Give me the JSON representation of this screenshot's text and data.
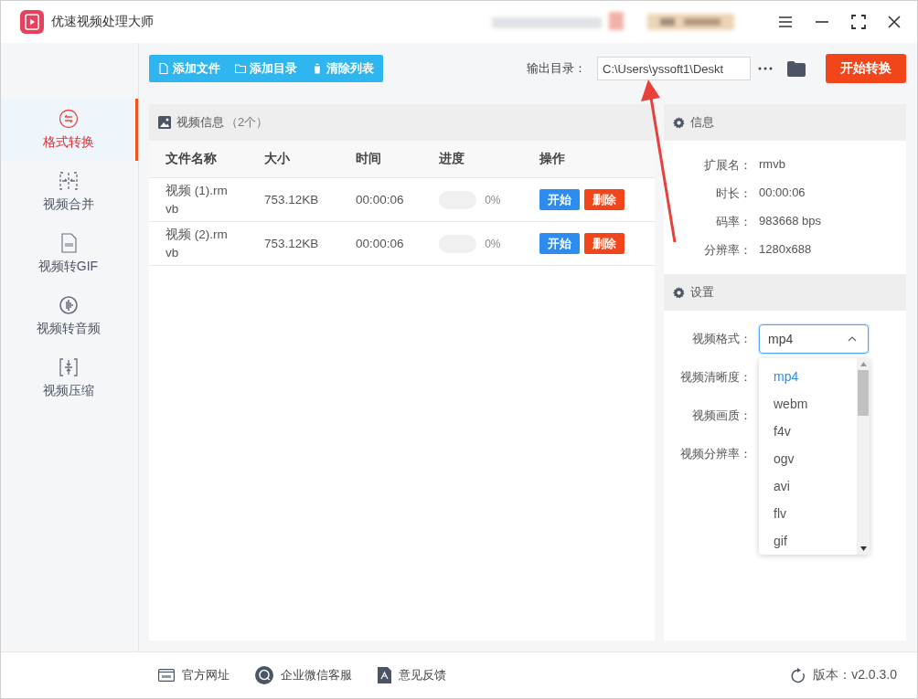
{
  "window": {
    "title": "优速视频处理大师"
  },
  "sidebar": {
    "items": [
      {
        "label": "格式转换",
        "selected": true
      },
      {
        "label": "视频合并",
        "selected": false
      },
      {
        "label": "视频转GIF",
        "selected": false
      },
      {
        "label": "视频转音频",
        "selected": false
      },
      {
        "label": "视频压缩",
        "selected": false
      }
    ]
  },
  "toolbar": {
    "buttons": [
      {
        "label": "添加文件"
      },
      {
        "label": "添加目录"
      },
      {
        "label": "清除列表"
      }
    ],
    "output_label": "输出目录：",
    "output_path": "C:\\Users\\yssoft1\\Deskt",
    "start_button": "开始转换"
  },
  "file_panel": {
    "title": "视频信息",
    "count": "（2个）",
    "columns": [
      "文件名称",
      "大小",
      "时间",
      "进度",
      "操作"
    ],
    "rows": [
      {
        "name": "视频 (1).rmvb",
        "size": "753.12KB",
        "time": "00:00:06",
        "level": 0,
        "progress": "0%",
        "start": "开始",
        "delete": "删除"
      },
      {
        "name": "视频 (2).rmvb",
        "size": "753.12KB",
        "time": "00:00:06",
        "level": 0,
        "progress": "0%",
        "start": "开始",
        "delete": "删除"
      }
    ]
  },
  "info_panel": {
    "title": "信息",
    "items": [
      {
        "label": "扩展名：",
        "value": "rmvb"
      },
      {
        "label": "时长：",
        "value": "00:00:06"
      },
      {
        "label": "码率：",
        "value": "983668 bps"
      },
      {
        "label": "分辨率：",
        "value": "1280x688"
      }
    ]
  },
  "settings_panel": {
    "title": "设置",
    "labels": [
      "视频格式：",
      "视频清晰度：",
      "视频画质：",
      "视频分辨率："
    ],
    "format_select": {
      "value": "mp4",
      "expanded": true,
      "options": [
        {
          "label": "mp4",
          "selected": true
        },
        {
          "label": "webm",
          "selected": false
        },
        {
          "label": "f4v",
          "selected": false
        },
        {
          "label": "ogv",
          "selected": false
        },
        {
          "label": "avi",
          "selected": false
        },
        {
          "label": "flv",
          "selected": false
        },
        {
          "label": "gif",
          "selected": false
        }
      ]
    }
  },
  "footer": {
    "links": [
      {
        "label": "官方网址"
      },
      {
        "label": "企业微信客服"
      },
      {
        "label": "意见反馈"
      }
    ],
    "version": "版本：v2.0.3.0"
  }
}
